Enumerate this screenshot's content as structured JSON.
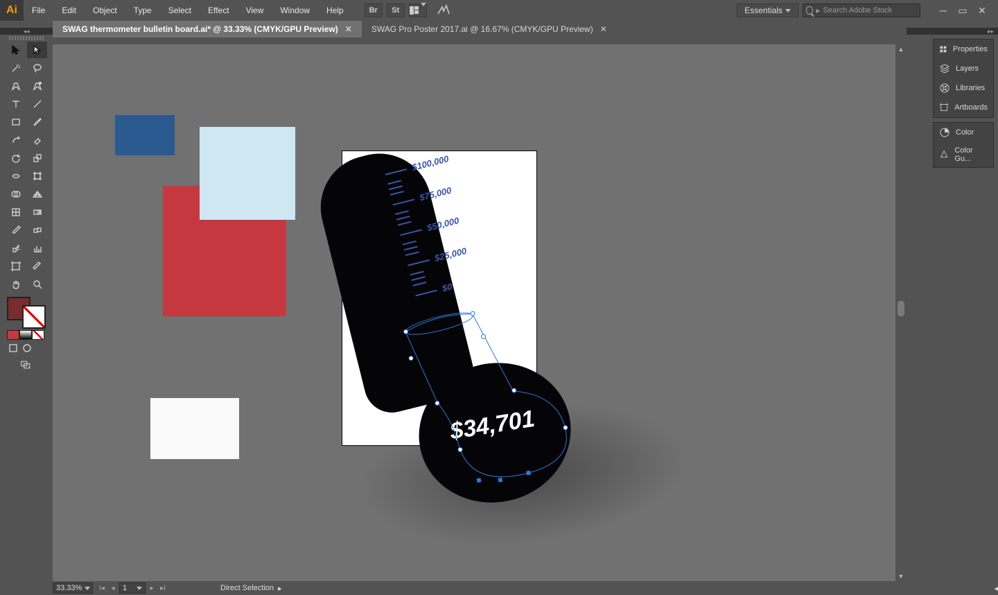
{
  "app": {
    "logo": "Ai"
  },
  "menu": [
    "File",
    "Edit",
    "Object",
    "Type",
    "Select",
    "Effect",
    "View",
    "Window",
    "Help"
  ],
  "topbar": {
    "br_label": "Br",
    "st_label": "St",
    "workspace": "Essentials",
    "search_placeholder": "Search Adobe Stock"
  },
  "tabs": [
    {
      "title": "SWAG thermometer bulletin board.ai* @ 33.33%  (CMYK/GPU Preview)",
      "active": true
    },
    {
      "title": "SWAG Pro Poster 2017.ai @ 16.67%  (CMYK/GPU Preview)",
      "active": false
    }
  ],
  "canvas": {
    "swatch_colors": {
      "blue": "#2a5a8f",
      "light_blue": "#cfe6f3",
      "red": "#c63840",
      "white": "#fafafa"
    },
    "thermo": {
      "scale": [
        "$100,000",
        "$75,000",
        "$50,000",
        "$25,000",
        "$0"
      ],
      "amount": "$34,701"
    }
  },
  "right_panels": {
    "group1": [
      {
        "label": "Properties"
      },
      {
        "label": "Layers"
      },
      {
        "label": "Libraries"
      },
      {
        "label": "Artboards"
      }
    ],
    "group2": [
      {
        "label": "Color"
      },
      {
        "label": "Color Gu..."
      }
    ]
  },
  "status": {
    "zoom": "33.33%",
    "artboard": "1",
    "tool": "Direct Selection"
  }
}
